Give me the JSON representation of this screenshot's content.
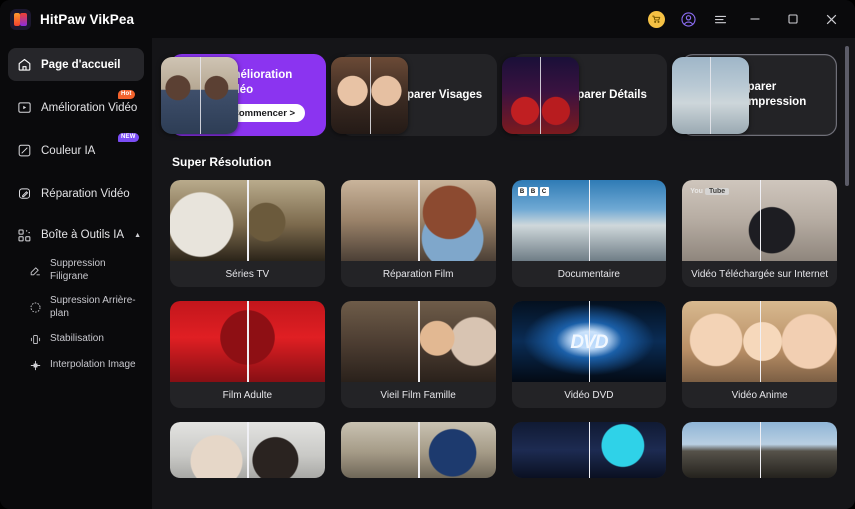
{
  "titlebar": {
    "brand": "HitPaw VikPea",
    "logo_icon": "hitpaw-logo-icon",
    "icons": [
      {
        "name": "cart-icon",
        "glyph": "cart"
      },
      {
        "name": "account-icon",
        "glyph": "user-circle"
      },
      {
        "name": "menu-icon",
        "glyph": "hamburger"
      }
    ],
    "window_controls": [
      {
        "name": "minimize-button",
        "glyph": "minimize"
      },
      {
        "name": "maximize-button",
        "glyph": "maximize"
      },
      {
        "name": "close-button",
        "glyph": "close"
      }
    ],
    "accent_purple": "#8b34f0",
    "accent_gold": "#f5c144"
  },
  "sidebar": {
    "items": [
      {
        "label": "Page d'accueil",
        "icon": "home-icon",
        "active": true,
        "badge": null
      },
      {
        "label": "Amélioration Vidéo",
        "icon": "video-enhance-icon",
        "active": false,
        "badge": "Hot"
      },
      {
        "label": "Couleur IA",
        "icon": "ai-color-icon",
        "active": false,
        "badge": "NEW"
      },
      {
        "label": "Réparation Vidéo",
        "icon": "video-repair-icon",
        "active": false,
        "badge": null
      }
    ],
    "group": {
      "label": "Boîte à Outils IA",
      "icon": "toolbox-icon",
      "caret": "▲",
      "expanded": true,
      "items": [
        {
          "label": "Suppression Filigrane",
          "icon": "watermark-remove-icon"
        },
        {
          "label": "Supression Arrière-plan",
          "icon": "background-remove-icon"
        },
        {
          "label": "Stabilisation",
          "icon": "stabilization-icon"
        },
        {
          "label": "Interpolation Image",
          "icon": "frame-interpolation-icon"
        }
      ]
    }
  },
  "main": {
    "feature_cards": [
      {
        "title": "Amélioration Vidéo",
        "button": "Commencer >",
        "primary": true,
        "selected": false,
        "photo": "ph-women"
      },
      {
        "title": "Réparer Visages",
        "button": null,
        "primary": false,
        "selected": false,
        "photo": "ph-faces"
      },
      {
        "title": "Réparer Détails",
        "button": null,
        "primary": false,
        "selected": false,
        "photo": "ph-night"
      },
      {
        "title": "Réparer Compression",
        "button": null,
        "primary": false,
        "selected": true,
        "photo": "ph-surf"
      }
    ],
    "section_title": "Super Résolution",
    "tiles": [
      {
        "label": "Séries TV",
        "photo": "ph-wedding",
        "overlay": null
      },
      {
        "label": "Réparation Film",
        "photo": "ph-film",
        "overlay": null
      },
      {
        "label": "Documentaire",
        "photo": "ph-doc",
        "overlay": "bbc"
      },
      {
        "label": "Vidéo Téléchargée sur Internet",
        "photo": "ph-web",
        "overlay": "youtube"
      },
      {
        "label": "Film Adulte",
        "photo": "ph-adult",
        "overlay": null
      },
      {
        "label": "Vieil Film Famille",
        "photo": "ph-family",
        "overlay": null
      },
      {
        "label": "Vidéo DVD",
        "photo": "ph-dvd",
        "overlay": "dvd"
      },
      {
        "label": "Vidéo Anime",
        "photo": "ph-anime",
        "overlay": null
      }
    ],
    "partial_tiles": [
      {
        "photo": "ph-couple"
      },
      {
        "photo": "ph-street"
      },
      {
        "photo": "ph-tablet"
      },
      {
        "photo": "ph-trees"
      }
    ],
    "overlays": {
      "bbc": [
        "B",
        "B",
        "C"
      ],
      "youtube_prefix": "You",
      "youtube_pill": "Tube",
      "dvd": "DVD"
    }
  }
}
